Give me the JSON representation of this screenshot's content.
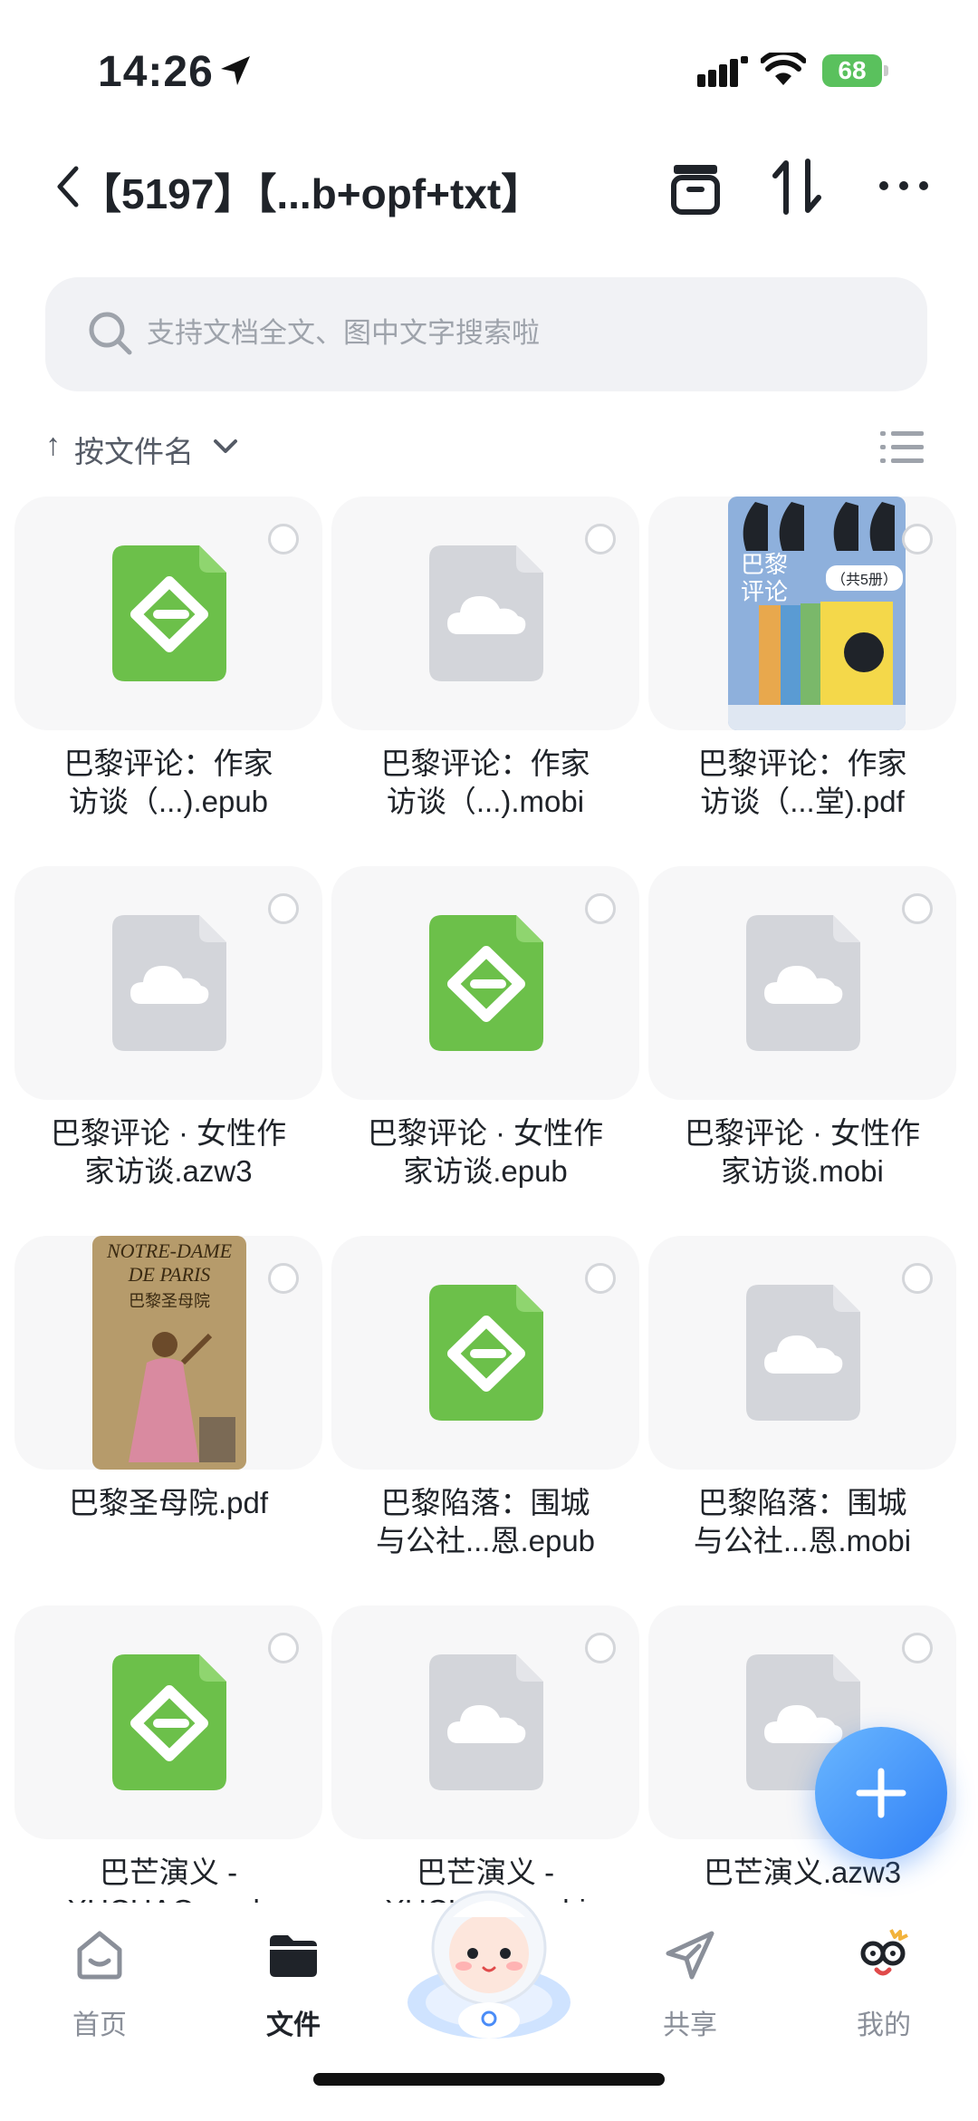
{
  "status_bar": {
    "time": "14:26",
    "battery": "68"
  },
  "header": {
    "title": "【5197】【...b+opf+txt】"
  },
  "search": {
    "placeholder": "支持文档全文、图中文字搜索啦"
  },
  "sort": {
    "arrow": "↑",
    "label": "按文件名"
  },
  "files": [
    {
      "name_line1": "巴黎评论：作家",
      "name_line2": "访谈（...).epub",
      "type": "epub"
    },
    {
      "name_line1": "巴黎评论：作家",
      "name_line2": "访谈（...).mobi",
      "type": "cloud"
    },
    {
      "name_line1": "巴黎评论：作家",
      "name_line2": "访谈（...堂).pdf",
      "type": "thumbnail",
      "thumb_text1": "巴黎",
      "thumb_text2": "评论",
      "thumb_text3": "（共5册）"
    },
    {
      "name_line1": "巴黎评论 · 女性作",
      "name_line2": "家访谈.azw3",
      "type": "cloud"
    },
    {
      "name_line1": "巴黎评论 · 女性作",
      "name_line2": "家访谈.epub",
      "type": "epub"
    },
    {
      "name_line1": "巴黎评论 · 女性作",
      "name_line2": "家访谈.mobi",
      "type": "cloud"
    },
    {
      "name_line1": "巴黎圣母院.pdf",
      "name_line2": "",
      "type": "thumbnail",
      "thumb_text1": "NOTRE-DAME",
      "thumb_text2": "DE PARIS",
      "thumb_text3": "巴黎圣母院"
    },
    {
      "name_line1": "巴黎陷落：围城",
      "name_line2": "与公社...恩.epub",
      "type": "epub"
    },
    {
      "name_line1": "巴黎陷落：围城",
      "name_line2": "与公社...恩.mobi",
      "type": "cloud"
    },
    {
      "name_line1": "巴芒演义 -",
      "name_line2": "XUCHAO.epub",
      "type": "epub"
    },
    {
      "name_line1": "巴芒演义 -",
      "name_line2": "XUCHAO.mobi",
      "type": "cloud"
    },
    {
      "name_line1": "巴芒演义.azw3",
      "name_line2": "",
      "type": "cloud"
    }
  ],
  "tabs": [
    {
      "label": "首页",
      "icon": "home-icon"
    },
    {
      "label": "文件",
      "icon": "folder-icon"
    },
    {
      "label": "",
      "icon": "mascot-icon"
    },
    {
      "label": "共享",
      "icon": "share-icon"
    },
    {
      "label": "我的",
      "icon": "profile-icon"
    }
  ],
  "colors": {
    "accent": "#2f7ff6",
    "epub_green": "#6cc04a",
    "cloud_gray": "#d3d5da",
    "battery_green": "#5ac15d"
  }
}
